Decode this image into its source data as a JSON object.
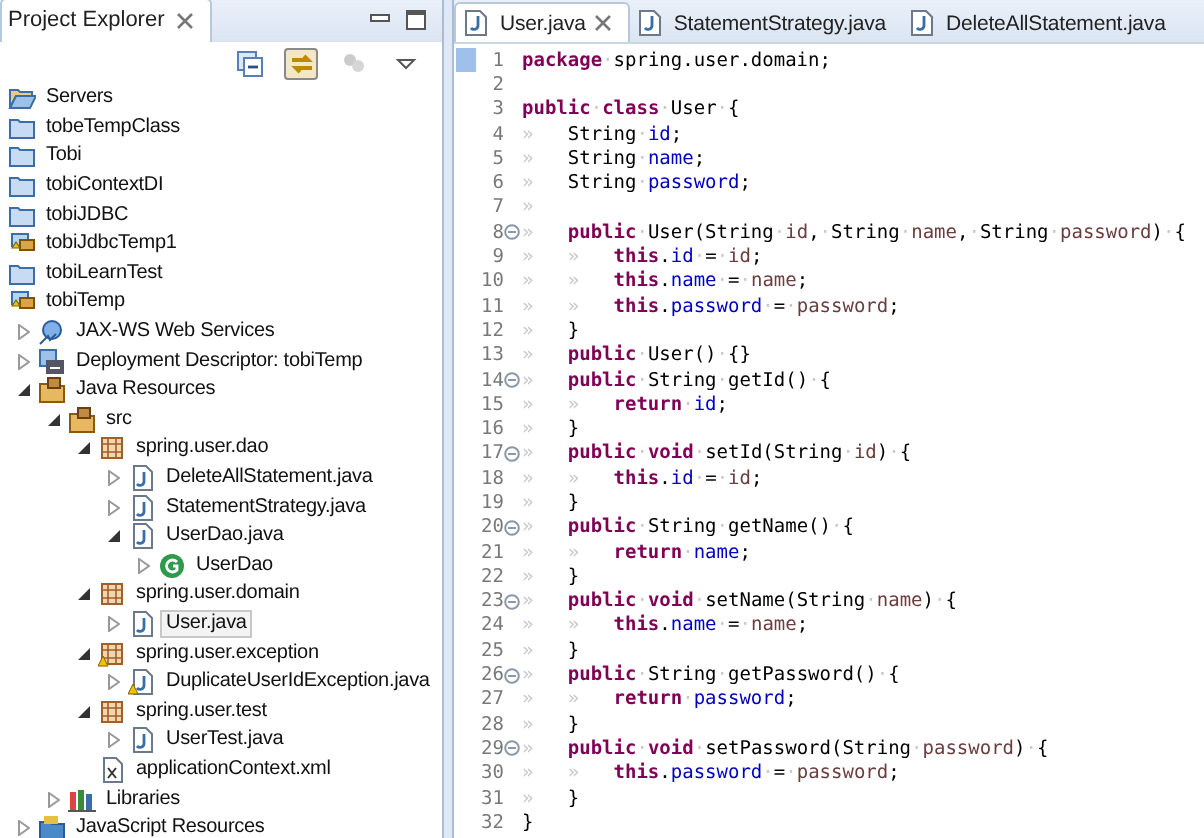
{
  "explorer": {
    "title": "Project Explorer",
    "toolbar": [
      {
        "kind": "collapse",
        "selected": false,
        "disabled": false
      },
      {
        "kind": "link",
        "selected": true,
        "disabled": false
      },
      {
        "kind": "filter",
        "selected": false,
        "disabled": true
      },
      {
        "kind": "menu",
        "selected": false,
        "disabled": false
      }
    ],
    "tree": [
      {
        "label": "Servers",
        "kind": "folder-open",
        "selected": false
      },
      {
        "label": "tobeTempClass",
        "kind": "project",
        "selected": false
      },
      {
        "label": "Tobi",
        "kind": "project",
        "selected": false
      },
      {
        "label": "tobiContextDI",
        "kind": "project",
        "selected": false
      },
      {
        "label": "tobiJDBC",
        "kind": "project",
        "selected": false
      },
      {
        "label": "tobiJdbcTemp1",
        "kind": "web-project",
        "selected": false
      },
      {
        "label": "tobiLearnTest",
        "kind": "project",
        "selected": false
      },
      {
        "label": "tobiTemp",
        "kind": "web-project",
        "selected": false,
        "children": [
          {
            "label": "JAX-WS Web Services",
            "kind": "web-services",
            "expanded": false,
            "selected": false
          },
          {
            "label": "Deployment Descriptor: tobiTemp",
            "kind": "descriptor",
            "expanded": false,
            "selected": false
          },
          {
            "label": "Java Resources",
            "kind": "java-resources",
            "expanded": true,
            "selected": false,
            "children": [
              {
                "label": "src",
                "kind": "source-folder",
                "expanded": true,
                "selected": false,
                "children": [
                  {
                    "label": "spring.user.dao",
                    "kind": "package",
                    "expanded": true,
                    "selected": false,
                    "children": [
                      {
                        "label": "DeleteAllStatement.java",
                        "kind": "java-file",
                        "expanded": false,
                        "selected": false
                      },
                      {
                        "label": "StatementStrategy.java",
                        "kind": "java-file",
                        "expanded": false,
                        "selected": false
                      },
                      {
                        "label": "UserDao.java",
                        "kind": "java-file",
                        "expanded": true,
                        "selected": false,
                        "children": [
                          {
                            "label": "UserDao",
                            "kind": "class",
                            "expanded": false,
                            "selected": false
                          }
                        ]
                      }
                    ]
                  },
                  {
                    "label": "spring.user.domain",
                    "kind": "package",
                    "expanded": true,
                    "selected": false,
                    "children": [
                      {
                        "label": "User.java",
                        "kind": "java-file",
                        "expanded": false,
                        "selected": true
                      }
                    ]
                  },
                  {
                    "label": "spring.user.exception",
                    "kind": "package-warning",
                    "expanded": true,
                    "selected": false,
                    "children": [
                      {
                        "label": "DuplicateUserIdException.java",
                        "kind": "java-file-warning",
                        "expanded": false,
                        "selected": false
                      }
                    ]
                  },
                  {
                    "label": "spring.user.test",
                    "kind": "package",
                    "expanded": true,
                    "selected": false,
                    "children": [
                      {
                        "label": "UserTest.java",
                        "kind": "java-file",
                        "expanded": false,
                        "selected": false
                      }
                    ]
                  },
                  {
                    "label": "applicationContext.xml",
                    "kind": "xml-file",
                    "selected": false
                  }
                ]
              },
              {
                "label": "Libraries",
                "kind": "libraries",
                "expanded": false,
                "selected": false
              }
            ]
          },
          {
            "label": "JavaScript Resources",
            "kind": "javascript",
            "expanded": false,
            "selected": false
          }
        ]
      }
    ]
  },
  "editor": {
    "tabs": [
      {
        "label": "User.java",
        "selected": true
      },
      {
        "label": "StatementStrategy.java",
        "selected": false
      },
      {
        "label": "DeleteAllStatement.java",
        "selected": false
      }
    ],
    "lines": [
      {
        "number": "1",
        "fold": false,
        "tokens": [
          {
            "kind": "kw",
            "text": "package"
          },
          {
            "kind": "ws",
            "text": "·"
          },
          {
            "kind": "text",
            "text": "spring.user.domain;"
          }
        ]
      },
      {
        "number": "2",
        "fold": false
      },
      {
        "number": "3",
        "fold": false,
        "tokens": [
          {
            "kind": "kw",
            "text": "public"
          },
          {
            "kind": "ws",
            "text": "·"
          },
          {
            "kind": "kw",
            "text": "class"
          },
          {
            "kind": "ws",
            "text": "·"
          },
          {
            "kind": "text",
            "text": "User"
          },
          {
            "kind": "ws",
            "text": "·"
          },
          {
            "kind": "text",
            "text": "{"
          }
        ]
      },
      {
        "number": "4",
        "fold": false,
        "tokens": [
          {
            "kind": "ws",
            "text": "»   "
          },
          {
            "kind": "text",
            "text": "String"
          },
          {
            "kind": "ws",
            "text": "·"
          },
          {
            "kind": "field",
            "text": "id"
          },
          {
            "kind": "text",
            "text": ";"
          }
        ]
      },
      {
        "number": "5",
        "fold": false,
        "tokens": [
          {
            "kind": "ws",
            "text": "»   "
          },
          {
            "kind": "text",
            "text": "String"
          },
          {
            "kind": "ws",
            "text": "·"
          },
          {
            "kind": "field",
            "text": "name"
          },
          {
            "kind": "text",
            "text": ";"
          }
        ]
      },
      {
        "number": "6",
        "fold": false,
        "tokens": [
          {
            "kind": "ws",
            "text": "»   "
          },
          {
            "kind": "text",
            "text": "String"
          },
          {
            "kind": "ws",
            "text": "·"
          },
          {
            "kind": "field",
            "text": "password"
          },
          {
            "kind": "text",
            "text": ";"
          }
        ]
      },
      {
        "number": "7",
        "fold": false,
        "tokens": [
          {
            "kind": "ws",
            "text": "»"
          }
        ]
      },
      {
        "number": "8",
        "fold": true,
        "tokens": [
          {
            "kind": "ws",
            "text": "»   "
          },
          {
            "kind": "kw",
            "text": "public"
          },
          {
            "kind": "ws",
            "text": "·"
          },
          {
            "kind": "text",
            "text": "User(String"
          },
          {
            "kind": "ws",
            "text": "·"
          },
          {
            "kind": "var",
            "text": "id"
          },
          {
            "kind": "text",
            "text": ","
          },
          {
            "kind": "ws",
            "text": "·"
          },
          {
            "kind": "text",
            "text": "String"
          },
          {
            "kind": "ws",
            "text": "·"
          },
          {
            "kind": "var",
            "text": "name"
          },
          {
            "kind": "text",
            "text": ","
          },
          {
            "kind": "ws",
            "text": "·"
          },
          {
            "kind": "text",
            "text": "String"
          },
          {
            "kind": "ws",
            "text": "·"
          },
          {
            "kind": "var",
            "text": "password"
          },
          {
            "kind": "text",
            "text": ")"
          },
          {
            "kind": "ws",
            "text": "·"
          },
          {
            "kind": "text",
            "text": "{"
          }
        ]
      },
      {
        "number": "9",
        "fold": false,
        "tokens": [
          {
            "kind": "ws",
            "text": "»   »   "
          },
          {
            "kind": "kw",
            "text": "this"
          },
          {
            "kind": "text",
            "text": "."
          },
          {
            "kind": "field",
            "text": "id"
          },
          {
            "kind": "ws",
            "text": "·"
          },
          {
            "kind": "text",
            "text": "="
          },
          {
            "kind": "ws",
            "text": "·"
          },
          {
            "kind": "var",
            "text": "id"
          },
          {
            "kind": "text",
            "text": ";"
          }
        ]
      },
      {
        "number": "10",
        "fold": false,
        "tokens": [
          {
            "kind": "ws",
            "text": "»   »   "
          },
          {
            "kind": "kw",
            "text": "this"
          },
          {
            "kind": "text",
            "text": "."
          },
          {
            "kind": "field",
            "text": "name"
          },
          {
            "kind": "ws",
            "text": "·"
          },
          {
            "kind": "text",
            "text": "="
          },
          {
            "kind": "ws",
            "text": "·"
          },
          {
            "kind": "var",
            "text": "name"
          },
          {
            "kind": "text",
            "text": ";"
          }
        ]
      },
      {
        "number": "11",
        "fold": false,
        "tokens": [
          {
            "kind": "ws",
            "text": "»   »   "
          },
          {
            "kind": "kw",
            "text": "this"
          },
          {
            "kind": "text",
            "text": "."
          },
          {
            "kind": "field",
            "text": "password"
          },
          {
            "kind": "ws",
            "text": "·"
          },
          {
            "kind": "text",
            "text": "="
          },
          {
            "kind": "ws",
            "text": "·"
          },
          {
            "kind": "var",
            "text": "password"
          },
          {
            "kind": "text",
            "text": ";"
          }
        ]
      },
      {
        "number": "12",
        "fold": false,
        "tokens": [
          {
            "kind": "ws",
            "text": "»   "
          },
          {
            "kind": "text",
            "text": "}"
          }
        ]
      },
      {
        "number": "13",
        "fold": false,
        "tokens": [
          {
            "kind": "ws",
            "text": "»   "
          },
          {
            "kind": "kw",
            "text": "public"
          },
          {
            "kind": "ws",
            "text": "·"
          },
          {
            "kind": "text",
            "text": "User()"
          },
          {
            "kind": "ws",
            "text": "·"
          },
          {
            "kind": "text",
            "text": "{}"
          }
        ]
      },
      {
        "number": "14",
        "fold": true,
        "tokens": [
          {
            "kind": "ws",
            "text": "»   "
          },
          {
            "kind": "kw",
            "text": "public"
          },
          {
            "kind": "ws",
            "text": "·"
          },
          {
            "kind": "text",
            "text": "String"
          },
          {
            "kind": "ws",
            "text": "·"
          },
          {
            "kind": "text",
            "text": "getId()"
          },
          {
            "kind": "ws",
            "text": "·"
          },
          {
            "kind": "text",
            "text": "{"
          }
        ]
      },
      {
        "number": "15",
        "fold": false,
        "tokens": [
          {
            "kind": "ws",
            "text": "»   »   "
          },
          {
            "kind": "kw",
            "text": "return"
          },
          {
            "kind": "ws",
            "text": "·"
          },
          {
            "kind": "field",
            "text": "id"
          },
          {
            "kind": "text",
            "text": ";"
          }
        ]
      },
      {
        "number": "16",
        "fold": false,
        "tokens": [
          {
            "kind": "ws",
            "text": "»   "
          },
          {
            "kind": "text",
            "text": "}"
          }
        ]
      },
      {
        "number": "17",
        "fold": true,
        "tokens": [
          {
            "kind": "ws",
            "text": "»   "
          },
          {
            "kind": "kw",
            "text": "public"
          },
          {
            "kind": "ws",
            "text": "·"
          },
          {
            "kind": "kw",
            "text": "void"
          },
          {
            "kind": "ws",
            "text": "·"
          },
          {
            "kind": "text",
            "text": "setId(String"
          },
          {
            "kind": "ws",
            "text": "·"
          },
          {
            "kind": "var",
            "text": "id"
          },
          {
            "kind": "text",
            "text": ")"
          },
          {
            "kind": "ws",
            "text": "·"
          },
          {
            "kind": "text",
            "text": "{"
          }
        ]
      },
      {
        "number": "18",
        "fold": false,
        "tokens": [
          {
            "kind": "ws",
            "text": "»   »   "
          },
          {
            "kind": "kw",
            "text": "this"
          },
          {
            "kind": "text",
            "text": "."
          },
          {
            "kind": "field",
            "text": "id"
          },
          {
            "kind": "ws",
            "text": "·"
          },
          {
            "kind": "text",
            "text": "="
          },
          {
            "kind": "ws",
            "text": "·"
          },
          {
            "kind": "var",
            "text": "id"
          },
          {
            "kind": "text",
            "text": ";"
          }
        ]
      },
      {
        "number": "19",
        "fold": false,
        "tokens": [
          {
            "kind": "ws",
            "text": "»   "
          },
          {
            "kind": "text",
            "text": "}"
          }
        ]
      },
      {
        "number": "20",
        "fold": true,
        "tokens": [
          {
            "kind": "ws",
            "text": "»   "
          },
          {
            "kind": "kw",
            "text": "public"
          },
          {
            "kind": "ws",
            "text": "·"
          },
          {
            "kind": "text",
            "text": "String"
          },
          {
            "kind": "ws",
            "text": "·"
          },
          {
            "kind": "text",
            "text": "getName()"
          },
          {
            "kind": "ws",
            "text": "·"
          },
          {
            "kind": "text",
            "text": "{"
          }
        ]
      },
      {
        "number": "21",
        "fold": false,
        "tokens": [
          {
            "kind": "ws",
            "text": "»   »   "
          },
          {
            "kind": "kw",
            "text": "return"
          },
          {
            "kind": "ws",
            "text": "·"
          },
          {
            "kind": "field",
            "text": "name"
          },
          {
            "kind": "text",
            "text": ";"
          }
        ]
      },
      {
        "number": "22",
        "fold": false,
        "tokens": [
          {
            "kind": "ws",
            "text": "»   "
          },
          {
            "kind": "text",
            "text": "}"
          }
        ]
      },
      {
        "number": "23",
        "fold": true,
        "tokens": [
          {
            "kind": "ws",
            "text": "»   "
          },
          {
            "kind": "kw",
            "text": "public"
          },
          {
            "kind": "ws",
            "text": "·"
          },
          {
            "kind": "kw",
            "text": "void"
          },
          {
            "kind": "ws",
            "text": "·"
          },
          {
            "kind": "text",
            "text": "setName(String"
          },
          {
            "kind": "ws",
            "text": "·"
          },
          {
            "kind": "var",
            "text": "name"
          },
          {
            "kind": "text",
            "text": ")"
          },
          {
            "kind": "ws",
            "text": "·"
          },
          {
            "kind": "text",
            "text": "{"
          }
        ]
      },
      {
        "number": "24",
        "fold": false,
        "tokens": [
          {
            "kind": "ws",
            "text": "»   »   "
          },
          {
            "kind": "kw",
            "text": "this"
          },
          {
            "kind": "text",
            "text": "."
          },
          {
            "kind": "field",
            "text": "name"
          },
          {
            "kind": "ws",
            "text": "·"
          },
          {
            "kind": "text",
            "text": "="
          },
          {
            "kind": "ws",
            "text": "·"
          },
          {
            "kind": "var",
            "text": "name"
          },
          {
            "kind": "text",
            "text": ";"
          }
        ]
      },
      {
        "number": "25",
        "fold": false,
        "tokens": [
          {
            "kind": "ws",
            "text": "»   "
          },
          {
            "kind": "text",
            "text": "}"
          }
        ]
      },
      {
        "number": "26",
        "fold": true,
        "tokens": [
          {
            "kind": "ws",
            "text": "»   "
          },
          {
            "kind": "kw",
            "text": "public"
          },
          {
            "kind": "ws",
            "text": "·"
          },
          {
            "kind": "text",
            "text": "String"
          },
          {
            "kind": "ws",
            "text": "·"
          },
          {
            "kind": "text",
            "text": "getPassword()"
          },
          {
            "kind": "ws",
            "text": "·"
          },
          {
            "kind": "text",
            "text": "{"
          }
        ]
      },
      {
        "number": "27",
        "fold": false,
        "tokens": [
          {
            "kind": "ws",
            "text": "»   »   "
          },
          {
            "kind": "kw",
            "text": "return"
          },
          {
            "kind": "ws",
            "text": "·"
          },
          {
            "kind": "field",
            "text": "password"
          },
          {
            "kind": "text",
            "text": ";"
          }
        ]
      },
      {
        "number": "28",
        "fold": false,
        "tokens": [
          {
            "kind": "ws",
            "text": "»   "
          },
          {
            "kind": "text",
            "text": "}"
          }
        ]
      },
      {
        "number": "29",
        "fold": true,
        "tokens": [
          {
            "kind": "ws",
            "text": "»   "
          },
          {
            "kind": "kw",
            "text": "public"
          },
          {
            "kind": "ws",
            "text": "·"
          },
          {
            "kind": "kw",
            "text": "void"
          },
          {
            "kind": "ws",
            "text": "·"
          },
          {
            "kind": "text",
            "text": "setPassword(String"
          },
          {
            "kind": "ws",
            "text": "·"
          },
          {
            "kind": "var",
            "text": "password"
          },
          {
            "kind": "text",
            "text": ")"
          },
          {
            "kind": "ws",
            "text": "·"
          },
          {
            "kind": "text",
            "text": "{"
          }
        ]
      },
      {
        "number": "30",
        "fold": false,
        "tokens": [
          {
            "kind": "ws",
            "text": "»   »   "
          },
          {
            "kind": "kw",
            "text": "this"
          },
          {
            "kind": "text",
            "text": "."
          },
          {
            "kind": "field",
            "text": "password"
          },
          {
            "kind": "ws",
            "text": "·"
          },
          {
            "kind": "text",
            "text": "="
          },
          {
            "kind": "ws",
            "text": "·"
          },
          {
            "kind": "var",
            "text": "password"
          },
          {
            "kind": "text",
            "text": ";"
          }
        ]
      },
      {
        "number": "31",
        "fold": false,
        "tokens": [
          {
            "kind": "ws",
            "text": "»   "
          },
          {
            "kind": "text",
            "text": "}"
          }
        ]
      },
      {
        "number": "32",
        "fold": false,
        "tokens": [
          {
            "kind": "text",
            "text": "}"
          }
        ]
      }
    ]
  }
}
